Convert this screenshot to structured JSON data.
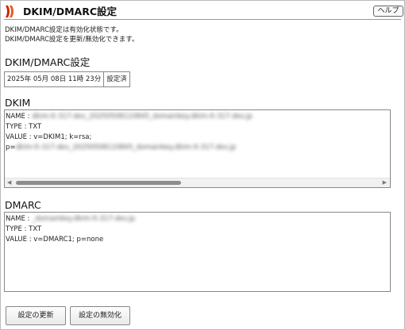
{
  "header": {
    "title": "DKIM/DMARC設定",
    "help_label": "ヘルプ",
    "brand_color": "#cc2200"
  },
  "description": [
    "DKIM/DMARC設定は有効化状態です。",
    "DKIM/DMARC設定を更新/無効化できます。"
  ],
  "settings": {
    "section_title": "DKIM/DMARC設定",
    "timestamp": "2025年 05月 08日 11時 23分",
    "status": "設定済"
  },
  "dkim": {
    "section_title": "DKIM",
    "name_prefix": "NAME : ",
    "name_value": "dkim-lt-317-dev_20250508110845_domainkey.dkim-lt-317-dev.jp",
    "type_line": "TYPE : TXT",
    "value_line": "VALUE : v=DKIM1; k=rsa;",
    "p_prefix": "p=",
    "p_value": "dkim-lt-317-dev_20250508110845_domainkey.dkim-lt-317-dev.jp"
  },
  "dmarc": {
    "section_title": "DMARC",
    "name_prefix": "NAME : ",
    "name_value": "_domainkey.dkim-lt-317-dev.jp",
    "type_line": "TYPE : TXT",
    "value_line": "VALUE : v=DMARC1; p=none"
  },
  "buttons": {
    "update_label": "設定の更新",
    "disable_label": "設定の無効化"
  },
  "icons": {
    "logo": "brand-logo-icon",
    "scroll_left": "arrow-left-icon",
    "scroll_right": "arrow-right-icon"
  }
}
